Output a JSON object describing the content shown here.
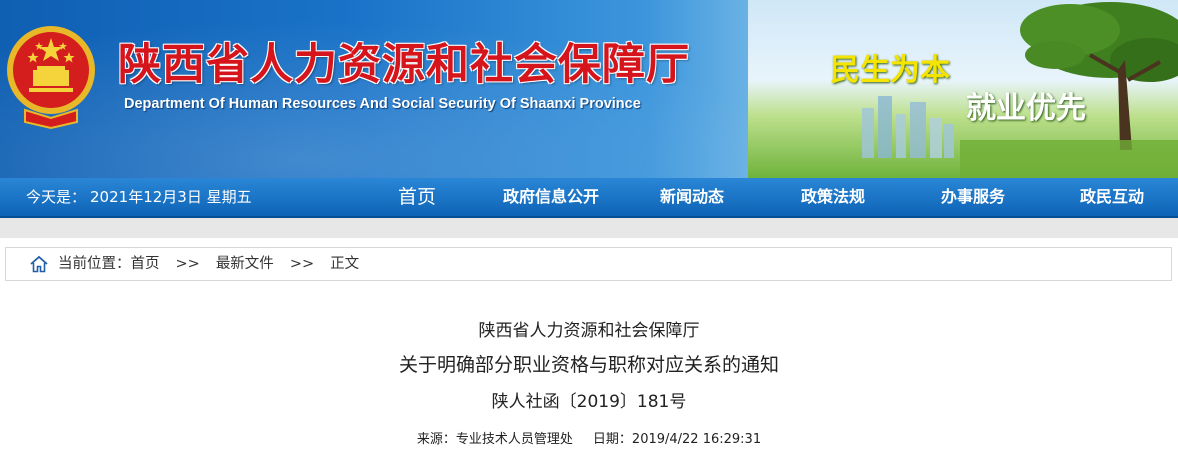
{
  "header": {
    "title_cn": "陕西省人力资源和社会保障厅",
    "title_en": "Department Of Human Resources And Social Security Of Shaanxi Province",
    "slogan_1": "民生为本",
    "slogan_2": "就业优先",
    "emblem_icon": "national-emblem-icon"
  },
  "navbar": {
    "date_label": "今天是：",
    "date_value": "2021年12月3日 星期五",
    "items": [
      {
        "label": "首页"
      },
      {
        "label": "政府信息公开"
      },
      {
        "label": "新闻动态"
      },
      {
        "label": "政策法规"
      },
      {
        "label": "办事服务"
      },
      {
        "label": "政民互动"
      }
    ]
  },
  "breadcrumb": {
    "icon": "home-icon",
    "prefix": "当前位置：",
    "items": [
      "首页",
      "最新文件",
      "正文"
    ],
    "separator": ">>"
  },
  "article": {
    "org": "陕西省人力资源和社会保障厅",
    "title": "关于明确部分职业资格与职称对应关系的通知",
    "doc_number": "陕人社函〔2019〕181号",
    "source_label": "来源：",
    "source_value": "专业技术人员管理处",
    "date_label": "日期：",
    "date_value": "2019/4/22 16:29:31"
  },
  "colors": {
    "title_red": "#d6141c",
    "nav_blue": "#0e64b6",
    "slogan_yellow": "#f4e400"
  }
}
